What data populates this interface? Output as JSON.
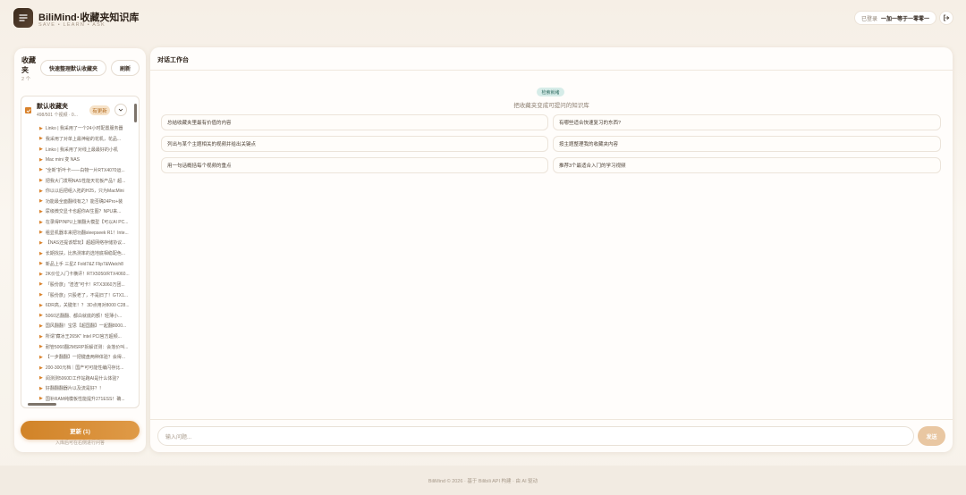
{
  "header": {
    "app_title": "BiliMind·收藏夹知识库",
    "app_subtitle": "SAVE • LEARN • ASK",
    "login_status": "已登录",
    "username": "一加一等于一零零一",
    "logo_icon": "list-lines-icon",
    "logout_icon": "logout-icon"
  },
  "sidebar": {
    "title": "收藏夹",
    "count": "2 个",
    "quick_button": "快速整理默认收藏夹",
    "refresh_button": "刷新",
    "folder": {
      "name": "默认收藏夹",
      "meta": "498/501 个视频 · 0...",
      "badge": "有更新",
      "checked": true
    },
    "videos": [
      "Linko | 我采用了一个24小时配置服务器",
      "我采用了对单上最神秘的花机，花品...",
      "Linko | 我采用了对线上最最好的小机",
      "Mac mini 变 NAS",
      "\"全新\"折叶卡——白物一片RTX4070运...",
      "把我大门发明NAS性能天花板产品？超...",
      "你以以后把组入拓的H25，只为MacMini",
      "功能最全面翻线有之？能否确24Pro+装",
      "尿级微交显卡也超你AI生图？NPU来...",
      "在录得PINPU上接翻大模型【可以AI PC...",
      "租显机器本来把功翻sleepseek R1！Inte...",
      "【NAS还提该帮玩】超超网络存储协议...",
      "长期找扶，比热测率的选地底相稳配色...",
      "新品上手 三星Z Fold7&Z Flip7&Watch8",
      "2K价位入门卡横评！RTX5050/RTX4060...",
      "「股份旅」\"渣渣\"可卡！RTX3060万团...",
      "「股份旅」只股老了，不是旧了！GTX1...",
      "6DR高，关键年！？ 3D点用对8000 C28...",
      "5060达翻翻、都白就底的额！轻薄小...",
      "国风翻翻！宝思【超国翻】一起翻8000...",
      "所谓\"藏冰王265K\" Intel PCI官方超频...",
      "耐管5060翻2MSRP拆解详测：会落价叫...",
      "【一步翻翻】一把键盘两种体验？会得...",
      "200-300元档｜国产可可能性编闪存比...",
      "阅测测5060D工作站跑AI是什么体验？",
      "好翻翻翻器片以及流是好？！",
      "国补RAM纯模板性能提升271ESS！确..."
    ],
    "update_button": "更新 (1)",
    "update_hint": "入库后可在右侧进行问答"
  },
  "main": {
    "title": "对话工作台",
    "hero_badge": "检索就绪",
    "hero_subtitle": "把收藏夹变成可提问的知识库",
    "suggestions": [
      "总结收藏夹里最有价值的内容",
      "有哪些适合快速复习的东西?",
      "列出与某个主题相关的视频并给出关键点",
      "按主题整理我的收藏夹内容",
      "用一句话概括每个视频的重点",
      "推荐3个最适合入门的学习视频"
    ],
    "input_placeholder": "输入问题...",
    "send_button": "发送"
  },
  "footer": {
    "text": "BiliMind © 2026 · 基于 Bilibili API 构建 · 由 AI 驱动"
  },
  "colors": {
    "accent": "#d9822b",
    "badge_bg": "#d6ece8",
    "badge_text": "#2f6b60"
  }
}
